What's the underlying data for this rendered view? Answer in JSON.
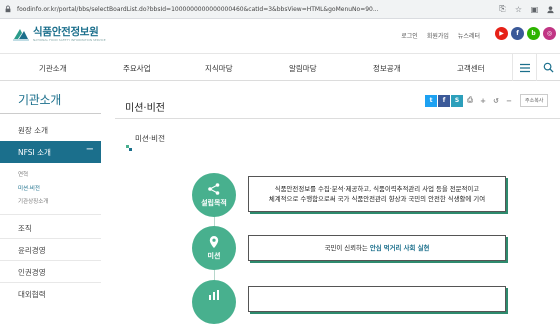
{
  "browser": {
    "url": "foodinfo.or.kr/portal/bbs/selectBoardList.do?bbsId=1000000000000000460&catId=3&bbsView=HTML&goMenuNo=90..."
  },
  "header": {
    "logo_ko": "식품안전정보원",
    "logo_en": "NATIONAL FOOD SAFETY INFORMATION SERVICE",
    "util_links": [
      "로그인",
      "회원가입",
      "뉴스레터"
    ],
    "sns": [
      {
        "name": "youtube",
        "color": "#e62117",
        "glyph": "▶"
      },
      {
        "name": "facebook",
        "color": "#3b5998",
        "glyph": "f"
      },
      {
        "name": "blog",
        "color": "#2db400",
        "glyph": "b"
      },
      {
        "name": "instagram",
        "color": "#c13584",
        "glyph": "◎"
      }
    ]
  },
  "nav": {
    "items": [
      "기관소개",
      "주요사업",
      "지식마당",
      "알림마당",
      "정보공개",
      "고객센터"
    ]
  },
  "sidebar": {
    "title": "기관소개",
    "items": [
      "원장 소개",
      "NFSI 소개",
      "조직",
      "윤리경영",
      "인권경영",
      "대외협력"
    ],
    "active_toggle": "−",
    "subitems": [
      "연혁",
      "미션·비전",
      "기관상징소개"
    ]
  },
  "content": {
    "title": "미션·비전",
    "subtitle": "미션·비전",
    "font_size_label": "주소복사",
    "rows": [
      {
        "label": "설립목적",
        "icon": "share-icon",
        "line1": "식품안전정보를 수집·분석·제공하고, 식품이력추적관리 사업 등을 전문적이고",
        "line2": "체계적으로 수행함으로써 국가 식품안전관리 향상과 국민의 안전한 식생활에 기여"
      },
      {
        "label": "미션",
        "icon": "pin-icon",
        "pre": "국민이 신뢰하는 ",
        "highlight": "안심 먹거리 사회 실현"
      },
      {
        "label": "",
        "icon": "chart-icon"
      }
    ]
  },
  "colors": {
    "brand": "#1b6f8c",
    "accent_green": "#48b08e"
  }
}
